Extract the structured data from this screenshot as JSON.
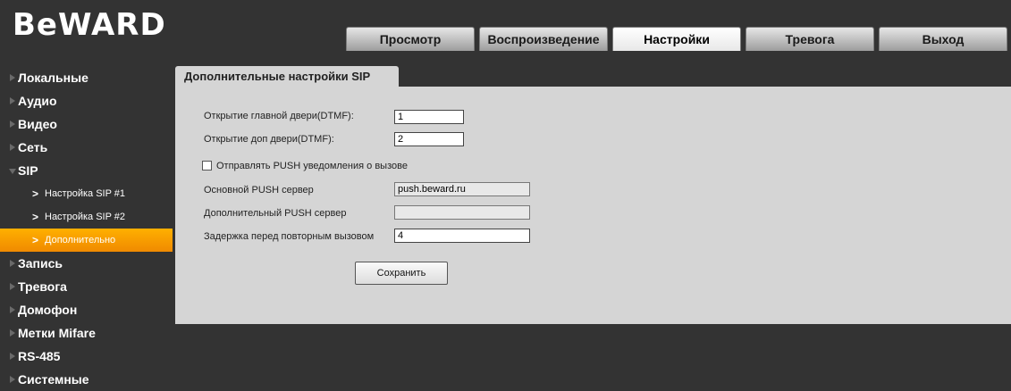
{
  "brand": {
    "logo_text": "BeWARD"
  },
  "nav": {
    "tabs": [
      {
        "label": "Просмотр"
      },
      {
        "label": "Воспроизведение"
      },
      {
        "label": "Настройки"
      },
      {
        "label": "Тревога"
      },
      {
        "label": "Выход"
      }
    ],
    "active": "Настройки"
  },
  "sidebar": {
    "items": [
      {
        "label": "Локальные"
      },
      {
        "label": "Аудио"
      },
      {
        "label": "Видео"
      },
      {
        "label": "Сеть"
      },
      {
        "label": "SIP"
      },
      {
        "label": "Запись"
      },
      {
        "label": "Тревога"
      },
      {
        "label": "Домофон"
      },
      {
        "label": "Метки Mifare"
      },
      {
        "label": "RS-485"
      },
      {
        "label": "Системные"
      }
    ],
    "sip_sub": [
      {
        "label": "Настройка SIP #1"
      },
      {
        "label": "Настройка SIP #2"
      },
      {
        "label": "Дополнительно"
      }
    ],
    "active_sub": "Дополнительно"
  },
  "panel": {
    "title": "Дополнительные настройки SIP",
    "main_door_label": "Открытие главной двери(DTMF):",
    "main_door_value": "1",
    "extra_door_label": "Открытие доп двери(DTMF):",
    "extra_door_value": "2",
    "push_checkbox_label": "Отправлять PUSH уведомления о вызове",
    "push_checked": false,
    "primary_push_label": "Основной PUSH сервер",
    "primary_push_value": "push.beward.ru",
    "secondary_push_label": "Дополнительный PUSH сервер",
    "secondary_push_value": "",
    "redial_delay_label": "Задержка перед повторным вызовом",
    "redial_delay_value": "4",
    "save_label": "Сохранить"
  },
  "colors": {
    "background": "#333333",
    "panel": "#d5d5d5",
    "active_item": "#f59a00"
  }
}
